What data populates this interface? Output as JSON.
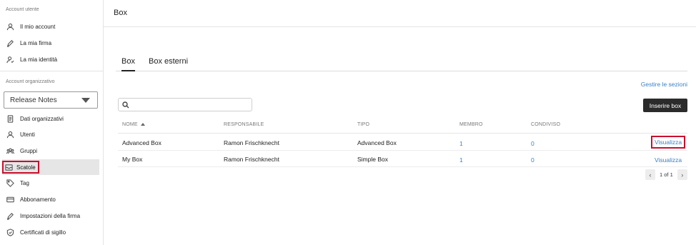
{
  "sidebar": {
    "user_section_title": "Account utente",
    "user_items": [
      {
        "label": "Il mio account",
        "icon": "user-icon"
      },
      {
        "label": "La mia firma",
        "icon": "pen-icon"
      },
      {
        "label": "La mia identità",
        "icon": "user-check-icon"
      }
    ],
    "org_section_title": "Account organizzativo",
    "org_select_value": "Release Notes",
    "org_items": [
      {
        "label": "Dati organizzativi",
        "icon": "document-icon"
      },
      {
        "label": "Utenti",
        "icon": "user-icon"
      },
      {
        "label": "Gruppi",
        "icon": "group-icon"
      },
      {
        "label": "Scatole",
        "icon": "inbox-icon",
        "active": true
      },
      {
        "label": "Tag",
        "icon": "tag-icon"
      },
      {
        "label": "Abbonamento",
        "icon": "card-icon"
      },
      {
        "label": "Impostazioni della firma",
        "icon": "pen-icon"
      },
      {
        "label": "Certificati di sigillo",
        "icon": "shield-check-icon"
      }
    ]
  },
  "main": {
    "title": "Box",
    "tabs": [
      {
        "label": "Box",
        "active": true
      },
      {
        "label": "Box esterni",
        "active": false
      }
    ],
    "manage_sections_label": "Gestire le sezioni",
    "search_placeholder": "",
    "insert_button_label": "Inserire box",
    "table": {
      "columns": [
        "NOME",
        "RESPONSABILE",
        "TIPO",
        "MEMBRO",
        "CONDIVISO"
      ],
      "rows": [
        {
          "nome": "Advanced Box",
          "responsabile": "Ramon Frischknecht",
          "tipo": "Advanced Box",
          "membro": "1",
          "condiviso": "0",
          "action": "Visualizza"
        },
        {
          "nome": "My Box",
          "responsabile": "Ramon Frischknecht",
          "tipo": "Simple Box",
          "membro": "1",
          "condiviso": "0",
          "action": "Visualizza"
        }
      ]
    },
    "pagination": {
      "text": "1 of 1",
      "prev": "‹",
      "next": "›"
    }
  },
  "colors": {
    "link": "#3b82c4",
    "highlight": "#c8102e",
    "button": "#2b2b2b"
  }
}
